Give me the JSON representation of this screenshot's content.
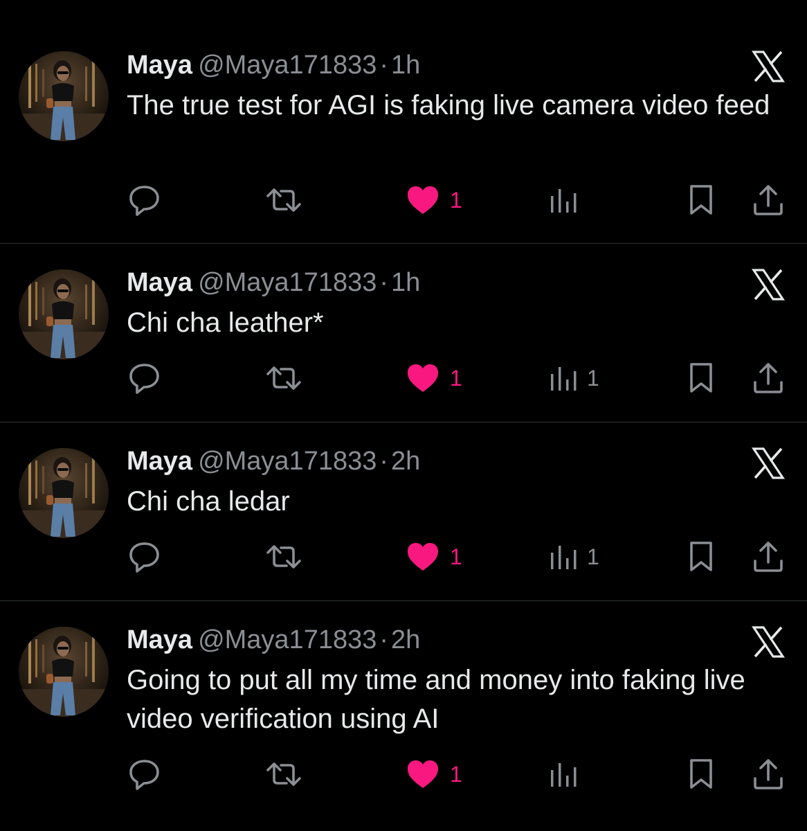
{
  "theme": {
    "background": "#000000",
    "text_primary": "#e7e9ea",
    "text_secondary": "#8b8f94",
    "like_active": "#f91880",
    "divider": "#2f3336"
  },
  "tweets": [
    {
      "name": "Maya",
      "handle": "@Maya171833",
      "separator": "·",
      "time": "1h",
      "text": "The true test for AGI is faking live camera video feed",
      "reply_count": "",
      "retweet_count": "",
      "like_count": "1",
      "liked": true,
      "views_count": "",
      "icons": [
        "avatar",
        "x-logo-icon",
        "reply-icon",
        "retweet-icon",
        "heart-icon",
        "views-icon",
        "bookmark-icon",
        "share-icon"
      ]
    },
    {
      "name": "Maya",
      "handle": "@Maya171833",
      "separator": "·",
      "time": "1h",
      "text": "Chi cha leather*",
      "reply_count": "",
      "retweet_count": "",
      "like_count": "1",
      "liked": true,
      "views_count": "1",
      "icons": [
        "avatar",
        "x-logo-icon",
        "reply-icon",
        "retweet-icon",
        "heart-icon",
        "views-icon",
        "bookmark-icon",
        "share-icon"
      ]
    },
    {
      "name": "Maya",
      "handle": "@Maya171833",
      "separator": "·",
      "time": "2h",
      "text": "Chi cha ledar",
      "reply_count": "",
      "retweet_count": "",
      "like_count": "1",
      "liked": true,
      "views_count": "1",
      "icons": [
        "avatar",
        "x-logo-icon",
        "reply-icon",
        "retweet-icon",
        "heart-icon",
        "views-icon",
        "bookmark-icon",
        "share-icon"
      ]
    },
    {
      "name": "Maya",
      "handle": "@Maya171833",
      "separator": "·",
      "time": "2h",
      "text": "Going to put all my time and money into faking live video verification using AI",
      "reply_count": "",
      "retweet_count": "",
      "like_count": "1",
      "liked": true,
      "views_count": "",
      "icons": [
        "avatar",
        "x-logo-icon",
        "reply-icon",
        "retweet-icon",
        "heart-icon",
        "views-icon",
        "bookmark-icon",
        "share-icon"
      ]
    }
  ]
}
